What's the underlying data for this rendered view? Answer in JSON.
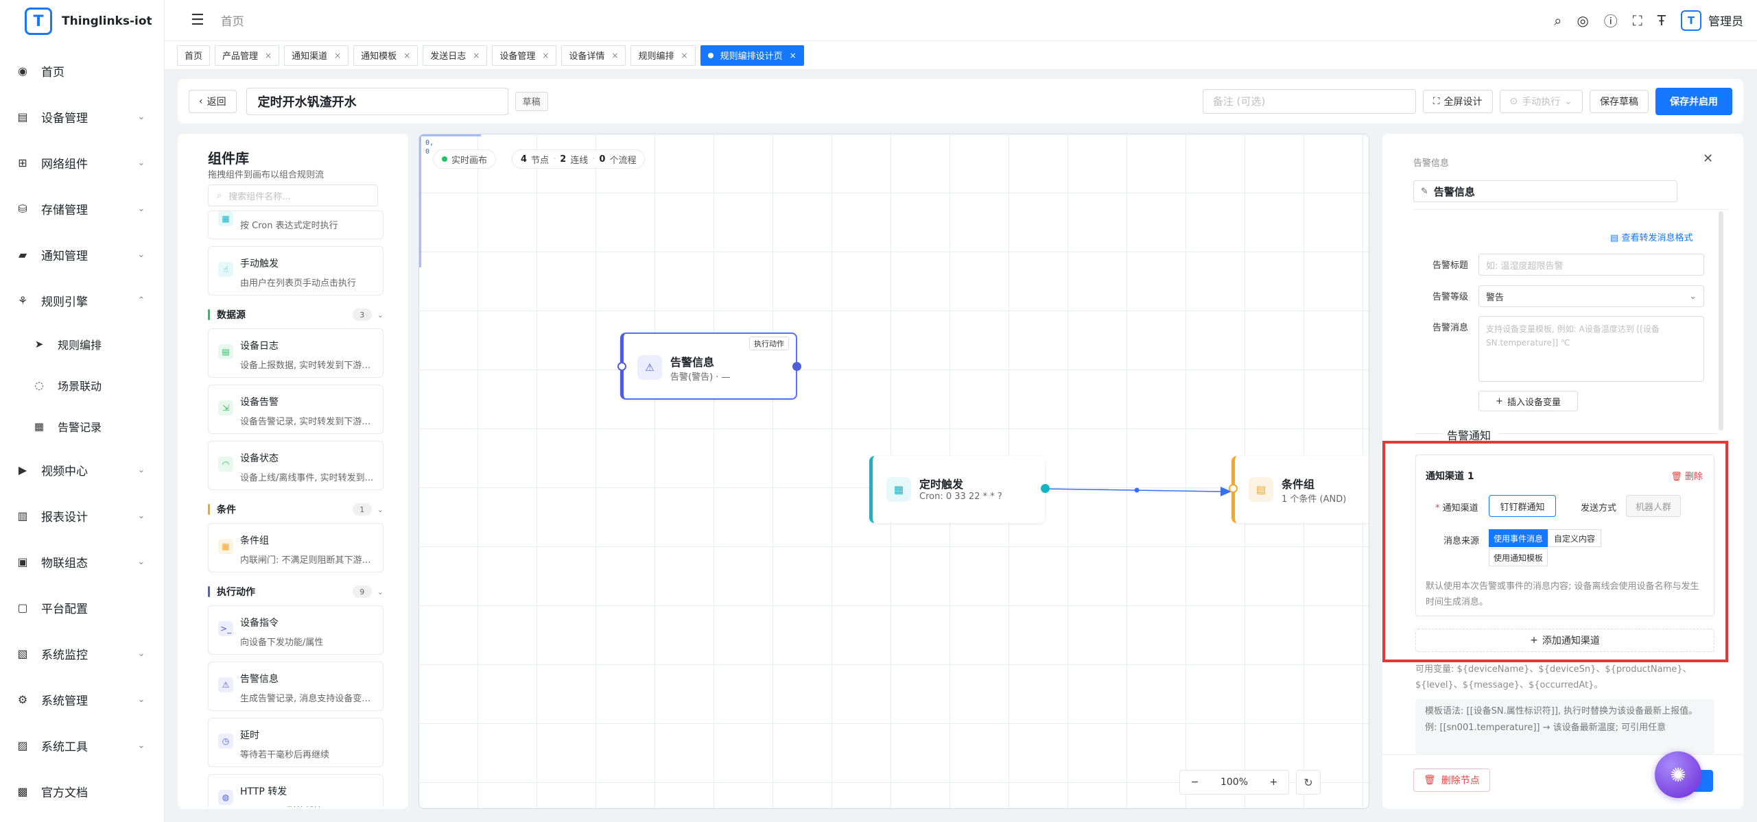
{
  "app": {
    "name": "Thinglinks-iot",
    "logo_mark": "T"
  },
  "sidebar": {
    "items": [
      {
        "label": "首页",
        "icon": "◉",
        "arrow": ""
      },
      {
        "label": "设备管理",
        "icon": "▤",
        "arrow": "⌄"
      },
      {
        "label": "网络组件",
        "icon": "⊞",
        "arrow": "⌄"
      },
      {
        "label": "存储管理",
        "icon": "⛁",
        "arrow": "⌄"
      },
      {
        "label": "通知管理",
        "icon": "▰",
        "arrow": "⌄"
      },
      {
        "label": "规则引擎",
        "icon": "⚘",
        "arrow": "⌃"
      }
    ],
    "sub_items": [
      {
        "label": "规则编排",
        "icon": "➤"
      },
      {
        "label": "场景联动",
        "icon": "◌"
      },
      {
        "label": "告警记录",
        "icon": "▦"
      }
    ],
    "items_after": [
      {
        "label": "视频中心",
        "icon": "▶",
        "arrow": "⌄"
      },
      {
        "label": "报表设计",
        "icon": "▥",
        "arrow": "⌄"
      },
      {
        "label": "物联组态",
        "icon": "▣",
        "arrow": "⌄"
      },
      {
        "label": "平台配置",
        "icon": "▢",
        "arrow": ""
      },
      {
        "label": "系统监控",
        "icon": "▧",
        "arrow": "⌄"
      },
      {
        "label": "系统管理",
        "icon": "⚙",
        "arrow": "⌄"
      },
      {
        "label": "系统工具",
        "icon": "▨",
        "arrow": "⌄"
      },
      {
        "label": "官方文档",
        "icon": "▩",
        "arrow": ""
      }
    ]
  },
  "header": {
    "breadcrumb": "首页",
    "user": "管理员",
    "user_logo": "T"
  },
  "tabs": [
    {
      "label": "首页",
      "closable": false,
      "active": false
    },
    {
      "label": "产品管理",
      "closable": true,
      "active": false
    },
    {
      "label": "通知渠道",
      "closable": true,
      "active": false
    },
    {
      "label": "通知模板",
      "closable": true,
      "active": false
    },
    {
      "label": "发送日志",
      "closable": true,
      "active": false
    },
    {
      "label": "设备管理",
      "closable": true,
      "active": false
    },
    {
      "label": "设备详情",
      "closable": true,
      "active": false
    },
    {
      "label": "规则编排",
      "closable": true,
      "active": false
    },
    {
      "label": "规则编排设计页",
      "closable": true,
      "active": true
    }
  ],
  "toolbar": {
    "back_label": "返回",
    "rule_name": "定时开水钒渣开水",
    "status_tag": "草稿",
    "remark_placeholder": "备注 (可选)",
    "fullscreen_label": "全屏设计",
    "manual_run_label": "手动执行",
    "save_draft_label": "保存草稿",
    "save_enable_label": "保存并启用"
  },
  "library": {
    "title": "组件库",
    "subtitle": "拖拽组件到画布以组合规则流",
    "search_placeholder": "搜索组件名称...",
    "top_cards": [
      {
        "title": "",
        "desc": "按 Cron 表达式定时执行",
        "icon": "▦",
        "color": "#13b5c5",
        "bg": "#e6f8fa"
      },
      {
        "title": "手动触发",
        "desc": "由用户在列表页手动点击执行",
        "icon": "☝",
        "color": "#13b5c5",
        "bg": "#e6f8fa"
      }
    ],
    "sections": [
      {
        "name": "数据源",
        "count": "3",
        "color": "#22c55e",
        "cards": [
          {
            "title": "设备日志",
            "desc": "设备上报数据, 实时转发到下游目...",
            "icon": "▤",
            "color": "#22c55e",
            "bg": "#e8f8ee"
          },
          {
            "title": "设备告警",
            "desc": "设备告警记录, 实时转发到下游目...",
            "icon": "⇲",
            "color": "#22c55e",
            "bg": "#e8f8ee"
          },
          {
            "title": "设备状态",
            "desc": "设备上线/离线事件, 实时转发到...",
            "icon": "◠",
            "color": "#22c55e",
            "bg": "#e8f8ee"
          }
        ]
      },
      {
        "name": "条件",
        "count": "1",
        "color": "#f5a623",
        "cards": [
          {
            "title": "条件组",
            "desc": "内联闸门: 不满足则阻断其下游分...",
            "icon": "▦",
            "color": "#f5a623",
            "bg": "#fdf3e2"
          }
        ]
      },
      {
        "name": "执行动作",
        "count": "9",
        "color": "#4f5ed8",
        "cards": [
          {
            "title": "设备指令",
            "desc": "向设备下发功能/属性",
            "icon": ">_",
            "color": "#4f5ed8",
            "bg": "#eceefd"
          },
          {
            "title": "告警信息",
            "desc": "生成告警记录, 消息支持设备变量...",
            "icon": "⚠",
            "color": "#4f5ed8",
            "bg": "#eceefd"
          },
          {
            "title": "延时",
            "desc": "等待若干毫秒后再继续",
            "icon": "◷",
            "color": "#4f5ed8",
            "bg": "#eceefd"
          },
          {
            "title": "HTTP 转发",
            "desc": "POST/PUT 到外部接口",
            "icon": "◍",
            "color": "#4f5ed8",
            "bg": "#eceefd"
          }
        ]
      }
    ]
  },
  "canvas": {
    "corner_text": "0,\n0",
    "live_label": "实时画布",
    "node_count": "4",
    "node_label": "节点",
    "edge_count": "2",
    "edge_label": "连线",
    "flow_count": "0",
    "flow_label": "个流程",
    "nodes": {
      "alarm": {
        "title": "告警信息",
        "subtitle": "告警(警告) · —",
        "tag": "执行动作",
        "icon": "⚠"
      },
      "timer": {
        "title": "定时触发",
        "subtitle": "Cron: 0 33 22 * * ?",
        "icon": "▦"
      },
      "cond": {
        "title": "条件组",
        "subtitle": "1 个条件 (AND)",
        "icon": "▤"
      }
    },
    "zoom_level": "100%",
    "zoom_out": "−",
    "zoom_in": "+"
  },
  "panel": {
    "header_label": "告警信息",
    "node_name": "告警信息",
    "view_format_link": "查看转发消息格式",
    "fields": {
      "title_label": "告警标题",
      "title_placeholder": "如: 温湿度超限告警",
      "level_label": "告警等级",
      "level_value": "警告",
      "message_label": "告警消息",
      "message_placeholder": "支持设备变量模板, 例如: A设备温度达到 [[设备SN.temperature]] ℃"
    },
    "insert_var_label": "插入设备变量",
    "notify_section": "告警通知",
    "channel": {
      "title": "通知渠道 1",
      "delete_label": "删除",
      "channel_label": "通知渠道",
      "channel_value": "钉钉群通知",
      "send_mode_label": "发送方式",
      "send_mode_value": "机器人群",
      "source_label": "消息来源",
      "source_options": [
        "使用事件消息",
        "自定义内容",
        "使用通知模板"
      ],
      "note": "默认使用本次告警或事件的消息内容; 设备离线会使用设备名称与发生时间生成消息。"
    },
    "add_channel_label": "添加通知渠道",
    "variables_text": "可用变量: ${deviceName}、${deviceSn}、${productName}、${level}、${message}、${occurredAt}。",
    "template_line1": "模板语法: [[设备SN.属性标识符]], 执行时替换为该设备最新上报值。",
    "template_line2": "例: [[sn001.temperature]] → 该设备最新温度; 可引用任意",
    "delete_node_label": "删除节点"
  },
  "colors": {
    "primary": "#1677ff",
    "danger": "#e54545",
    "highlight": "#e53935"
  }
}
